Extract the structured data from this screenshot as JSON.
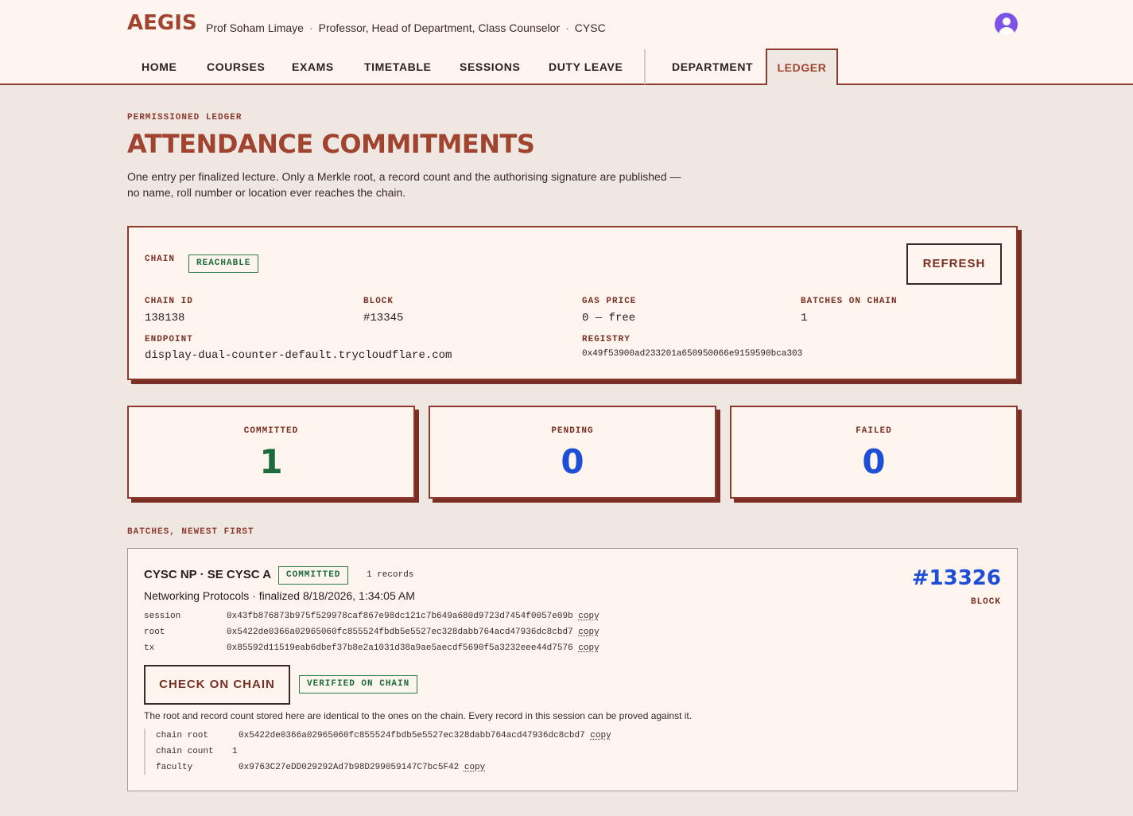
{
  "app": {
    "logo": "AEGIS"
  },
  "user": {
    "name": "Prof Soham Limaye",
    "roles": "Professor, Head of Department, Class Counselor",
    "dept": "CYSC",
    "separator": "·"
  },
  "nav": {
    "items": [
      "HOME",
      "COURSES",
      "EXAMS",
      "TIMETABLE",
      "SESSIONS",
      "DUTY LEAVE",
      "DEPARTMENT",
      "LEDGER"
    ],
    "active": "LEDGER"
  },
  "page": {
    "eyebrow": "PERMISSIONED LEDGER",
    "title": "ATTENDANCE COMMITMENTS",
    "description": "One entry per finalized lecture. Only a Merkle root, a record count and the authorising signature are published — no name, roll number or location ever reaches the chain."
  },
  "chain": {
    "label": "CHAIN",
    "status": "REACHABLE",
    "refresh_label": "REFRESH",
    "chain_id_label": "CHAIN ID",
    "chain_id": "138138",
    "block_label": "BLOCK",
    "block": "#13345",
    "gas_label": "GAS PRICE",
    "gas": "0 — free",
    "batches_label": "BATCHES ON CHAIN",
    "batches": "1",
    "endpoint_label": "ENDPOINT",
    "endpoint": "display-dual-counter-default.trycloudflare.com",
    "registry_label": "REGISTRY",
    "registry": "0x49f53900ad233201a650950066e9159590bca303"
  },
  "stats": {
    "committed_label": "COMMITTED",
    "committed": "1",
    "pending_label": "PENDING",
    "pending": "0",
    "failed_label": "FAILED",
    "failed": "0"
  },
  "batches": {
    "heading": "BATCHES, NEWEST FIRST",
    "items": [
      {
        "title": "CYSC NP · SE CYSC A",
        "status": "COMMITTED",
        "records": "1 records",
        "subtitle": "Networking Protocols · finalized 8/18/2026, 1:34:05 AM",
        "block": "#13326",
        "block_label": "BLOCK",
        "session_label": "session",
        "session": "0x43fb876873b975f529978caf867e98dc121c7b649a680d9723d7454f0057e09b",
        "root_label": "root",
        "root": "0x5422de0366a02965060fc855524fbdb5e5527ec328dabb764acd47936dc8cbd7",
        "tx_label": "tx",
        "tx": "0x85592d11519eab6dbef37b8e2a1031d38a9ae5aecdf5690f5a3232eee44d7576",
        "copy_label": "copy",
        "check_label": "CHECK ON CHAIN",
        "verified": "VERIFIED ON CHAIN",
        "verify_note": "The root and record count stored here are identical to the ones on the chain. Every record in this session can be proved against it.",
        "chain_root_label": "chain root",
        "chain_root": "0x5422de0366a02965060fc855524fbdb5e5527ec328dabb764acd47936dc8cbd7",
        "chain_count_label": "chain count",
        "chain_count": "1",
        "faculty_label": "faculty",
        "faculty": "0x9763C27eDD029292Ad7b98D299059147C7bc5F42"
      }
    ]
  },
  "colors": {
    "accent": "#a0432f",
    "committed": "#1c6b3a",
    "pending": "#1f4ed6",
    "failed": "#1f4ed6",
    "avatar": "#7d52e6"
  }
}
